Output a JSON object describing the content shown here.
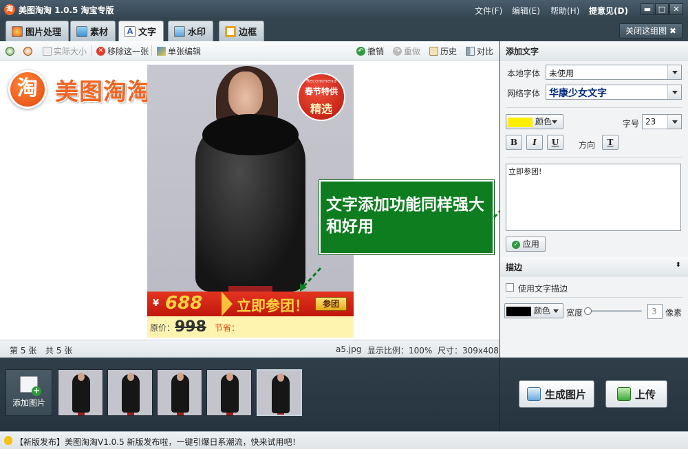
{
  "app": {
    "logo_char": "淘",
    "title": "美图淘淘 1.0.5 淘宝专版"
  },
  "menu": {
    "file": "文件(F)",
    "edit": "编辑(E)",
    "help": "帮助(H)",
    "feedback": "提意见(D)"
  },
  "window_buttons": {
    "minimize": "▬",
    "maximize": "□",
    "close": "✕"
  },
  "tabs": [
    {
      "label": "图片处理"
    },
    {
      "label": "素材"
    },
    {
      "label": "文字"
    },
    {
      "label": "水印"
    },
    {
      "label": "边框"
    }
  ],
  "active_tab": "文字",
  "close_group_label": "关闭这组图 ✖",
  "toolbar": {
    "actual_size": "实际大小",
    "remove_this": "移除这一张",
    "single_edit": "单张编辑",
    "undo": "撤销",
    "redo": "重做",
    "history": "历史",
    "compare": "对比"
  },
  "canvas": {
    "brand_logo_char": "淘",
    "brand_logo_text": "美图淘淘",
    "promo_badge": {
      "top": "Recommend",
      "mid": "春节特供",
      "bottom": "精选"
    },
    "price": {
      "currency": "¥",
      "value": "688",
      "cta": "立即参团！",
      "button": "参团"
    },
    "original": {
      "label": "原价：",
      "value": "998",
      "note": "节省："
    },
    "callout_text": "文字添加功能同样强大和好用"
  },
  "statusbar": {
    "current": "第 5 张",
    "total": "共 5 张",
    "filename": "a5.jpg",
    "ratio": "显示比例：100%",
    "size": "尺寸：309x408"
  },
  "side": {
    "add_text_header": "添加文字",
    "local_font_label": "本地字体",
    "local_font_value": "未使用",
    "web_font_label": "网络字体",
    "web_font_value": "华康少女文字",
    "color_label": "颜色",
    "color_swatch": "#ffee00",
    "size_label": "字号",
    "size_value": "23",
    "bold": "B",
    "italic": "I",
    "underline": "U",
    "direction_label": "方向",
    "direction_btn": "T",
    "text_content": "立即参团!",
    "apply": "应用",
    "stroke_header": "描边",
    "use_stroke": "使用文字描边",
    "stroke_color_label": "颜色",
    "stroke_color_swatch": "#000000",
    "width_label": "宽度",
    "width_value": "3",
    "width_unit": "像素"
  },
  "strip": {
    "add_image": "添加图片",
    "generate": "生成图片",
    "upload": "上传"
  },
  "notice": "【新版发布】美图淘淘V1.0.5 新版发布啦，一键引爆日系潮流，快来试用吧！"
}
